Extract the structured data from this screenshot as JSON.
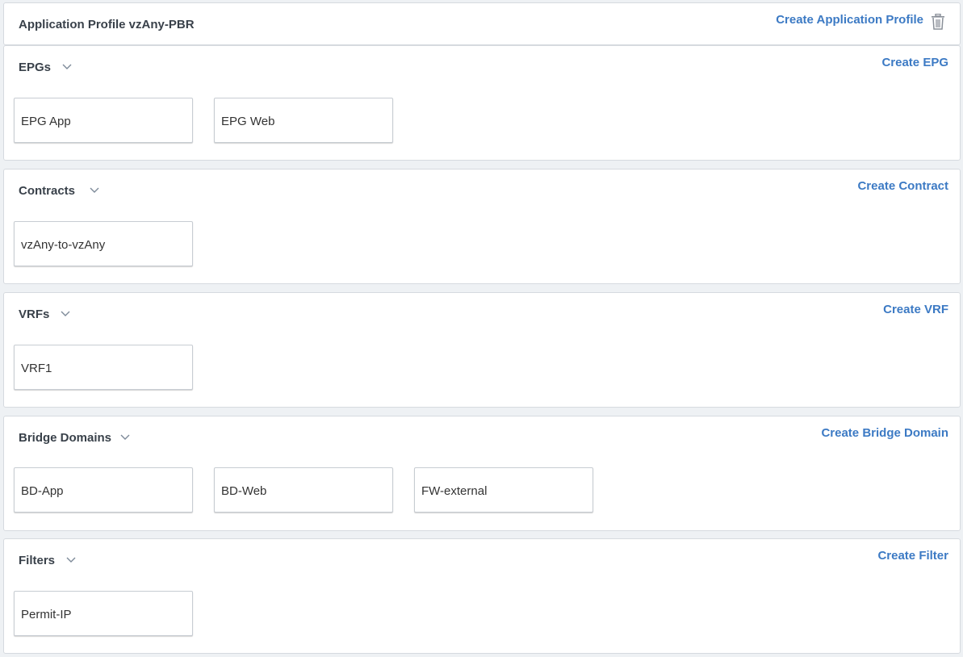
{
  "app_profile": {
    "title": "Application Profile vzAny-PBR",
    "create_label": "Create Application Profile",
    "delete_icon": "trash-icon"
  },
  "sections": {
    "epgs": {
      "title": "EPGs",
      "create_label": "Create EPG",
      "items": [
        "EPG App",
        "EPG Web"
      ]
    },
    "contracts": {
      "title": "Contracts",
      "create_label": "Create Contract",
      "items": [
        "vzAny-to-vzAny"
      ]
    },
    "vrfs": {
      "title": "VRFs",
      "create_label": "Create VRF",
      "items": [
        "VRF1"
      ]
    },
    "bridge_domains": {
      "title": "Bridge Domains",
      "create_label": "Create Bridge Domain",
      "items": [
        "BD-App",
        "BD-Web",
        "FW-external"
      ]
    },
    "filters": {
      "title": "Filters",
      "create_label": "Create Filter",
      "items": [
        "Permit-IP"
      ]
    }
  },
  "colors": {
    "link": "#3c7ac4",
    "title": "#39414a",
    "border": "#d6dadf"
  }
}
